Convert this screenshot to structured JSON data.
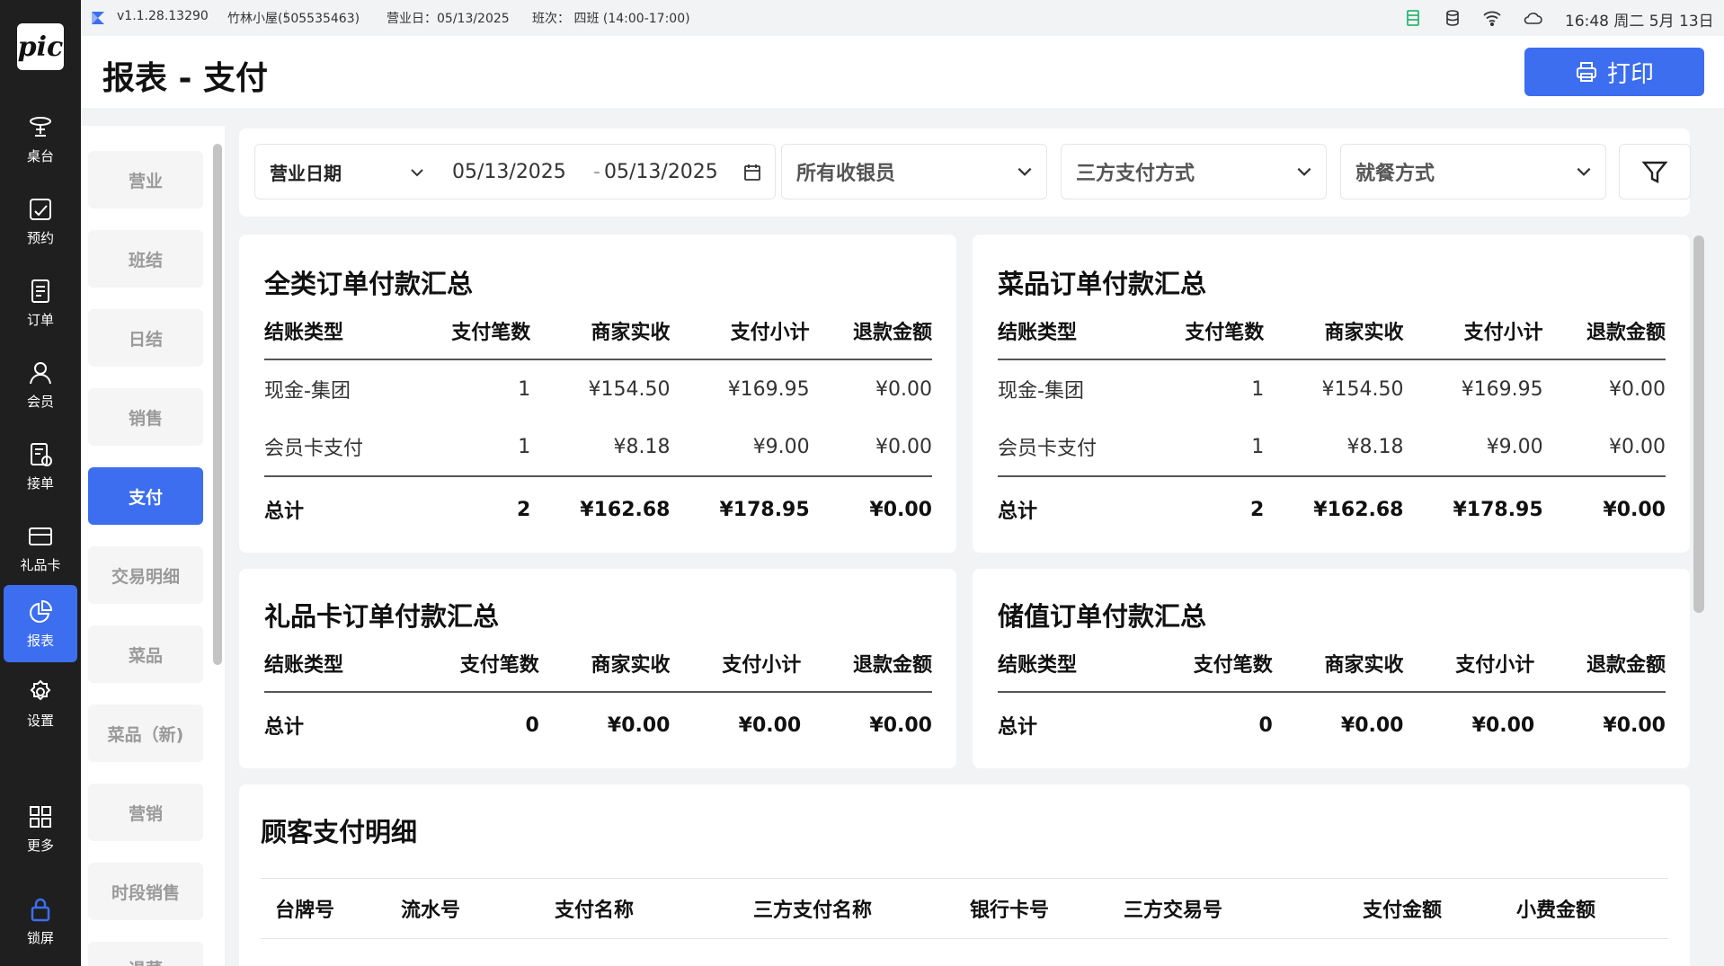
{
  "statusbar": {
    "version": "v1.1.28.13290",
    "store": "竹林小屋(505535463)",
    "business_date": "营业日：05/13/2025",
    "shift": "班次： 四班 (14:00-17:00)",
    "time": "16:48 周二 5月 13日"
  },
  "logo": "pic",
  "leftnav": [
    {
      "label": "桌台",
      "icon": "table-icon"
    },
    {
      "label": "预约",
      "icon": "calendar-check-icon"
    },
    {
      "label": "订单",
      "icon": "order-icon"
    },
    {
      "label": "会员",
      "icon": "user-icon"
    },
    {
      "label": "接单",
      "icon": "receive-order-icon"
    },
    {
      "label": "礼品卡",
      "icon": "gift-card-icon"
    },
    {
      "label": "报表",
      "icon": "pie-chart-icon"
    },
    {
      "label": "设置",
      "icon": "gear-icon"
    },
    {
      "label": "更多",
      "icon": "grid-icon"
    },
    {
      "label": "锁屏",
      "icon": "lock-icon"
    }
  ],
  "header": {
    "title": "报表 - 支付",
    "print_label": "打印"
  },
  "subnav": [
    "营业",
    "班结",
    "日结",
    "销售",
    "支付",
    "交易明细",
    "菜品",
    "菜品（新)",
    "营销",
    "时段销售",
    "退菜"
  ],
  "filters": {
    "date_type": "营业日期",
    "date_from": "05/13/2025",
    "date_sep": "-",
    "date_to": "05/13/2025",
    "cashier": "所有收银员",
    "third_party": "三方支付方式",
    "dining": "就餐方式"
  },
  "columns": [
    "结账类型",
    "支付笔数",
    "商家实收",
    "支付小计",
    "退款金额"
  ],
  "cards": {
    "all": {
      "title": "全类订单付款汇总",
      "rows": [
        [
          "现金-集团",
          "1",
          "¥154.50",
          "¥169.95",
          "¥0.00"
        ],
        [
          "会员卡支付",
          "1",
          "¥8.18",
          "¥9.00",
          "¥0.00"
        ]
      ],
      "total": [
        "总计",
        "2",
        "¥162.68",
        "¥178.95",
        "¥0.00"
      ]
    },
    "dish": {
      "title": "菜品订单付款汇总",
      "rows": [
        [
          "现金-集团",
          "1",
          "¥154.50",
          "¥169.95",
          "¥0.00"
        ],
        [
          "会员卡支付",
          "1",
          "¥8.18",
          "¥9.00",
          "¥0.00"
        ]
      ],
      "total": [
        "总计",
        "2",
        "¥162.68",
        "¥178.95",
        "¥0.00"
      ]
    },
    "gift": {
      "title": "礼品卡订单付款汇总",
      "total": [
        "总计",
        "0",
        "¥0.00",
        "¥0.00",
        "¥0.00"
      ]
    },
    "stored": {
      "title": "储值订单付款汇总",
      "total": [
        "总计",
        "0",
        "¥0.00",
        "¥0.00",
        "¥0.00"
      ]
    }
  },
  "customer": {
    "title": "顾客支付明细",
    "columns": [
      "台牌号",
      "流水号",
      "支付名称",
      "三方支付名称",
      "银行卡号",
      "三方交易号",
      "支付金额",
      "小费金额"
    ]
  }
}
